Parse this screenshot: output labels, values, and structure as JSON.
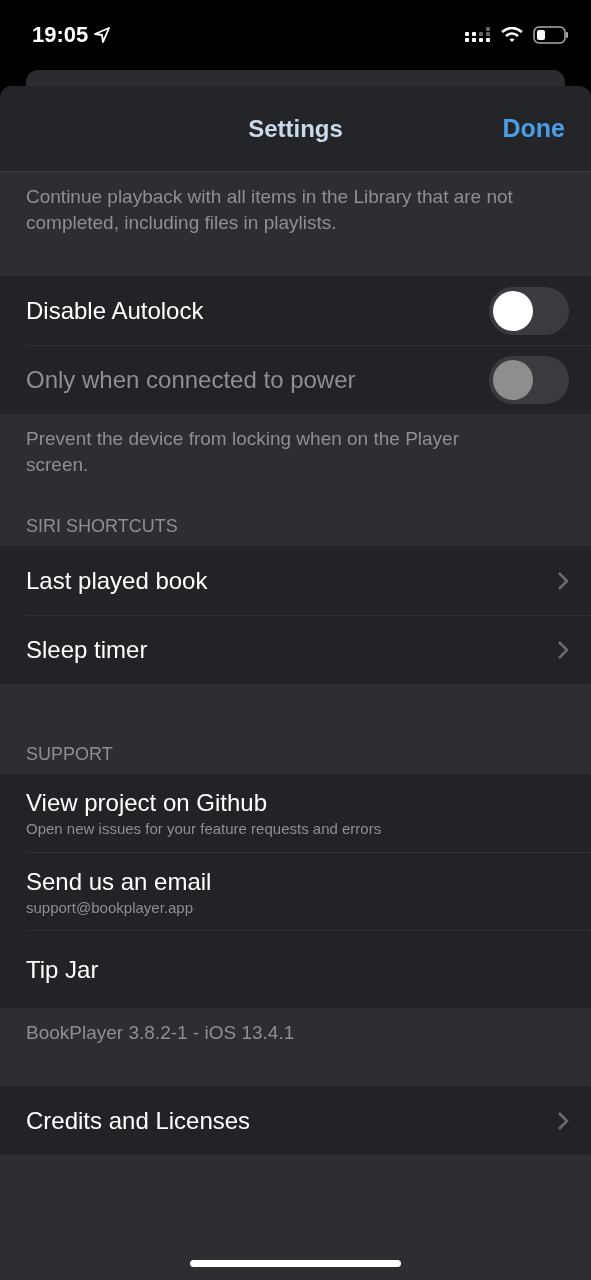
{
  "status_bar": {
    "time": "19:05"
  },
  "nav": {
    "title": "Settings",
    "done": "Done"
  },
  "sections": [
    {
      "footer": "Continue playback with all items in the Library that are not completed, including files in playlists."
    },
    {
      "rows": [
        {
          "kind": "toggle",
          "title": "Disable Autolock",
          "on": false,
          "disabled": false
        },
        {
          "kind": "toggle",
          "title": "Only when connected to power",
          "on": false,
          "disabled": true
        }
      ],
      "footer": "Prevent the device from locking when on the Player screen."
    },
    {
      "header": "SIRI SHORTCUTS",
      "rows": [
        {
          "kind": "disclosure",
          "title": "Last played book"
        },
        {
          "kind": "disclosure",
          "title": "Sleep timer"
        }
      ]
    },
    {
      "header": "SUPPORT",
      "rows": [
        {
          "kind": "subtitle",
          "title": "View project on Github",
          "subtitle": "Open new issues for your feature requests and errors"
        },
        {
          "kind": "subtitle",
          "title": "Send us an email",
          "subtitle": "support@bookplayer.app"
        },
        {
          "kind": "plain",
          "title": "Tip Jar"
        }
      ],
      "footer": "BookPlayer 3.8.2-1 - iOS 13.4.1"
    },
    {
      "rows": [
        {
          "kind": "disclosure",
          "title": "Credits and Licenses"
        }
      ]
    }
  ]
}
